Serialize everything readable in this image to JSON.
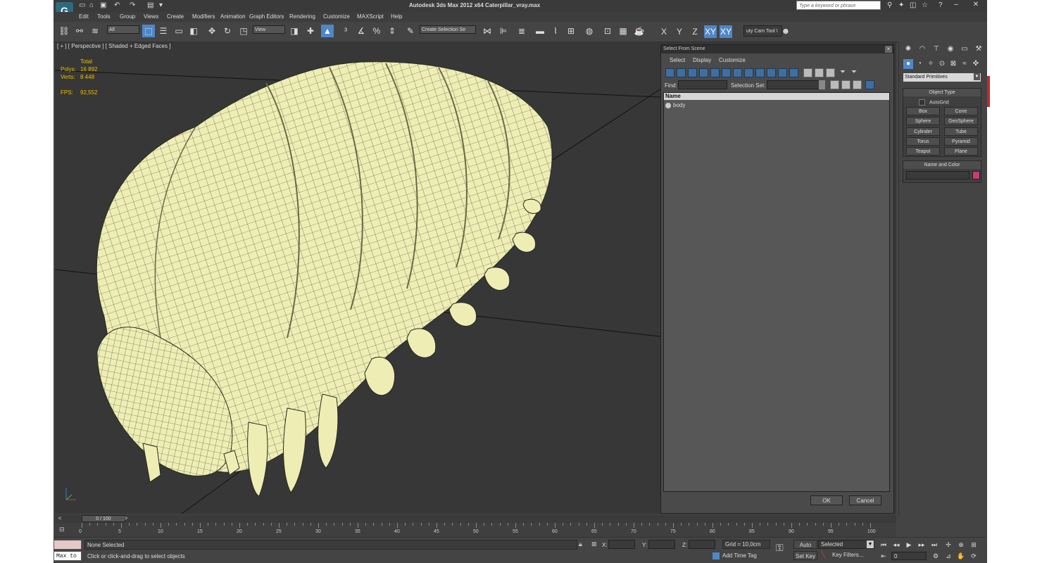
{
  "app": {
    "title": "Autodesk 3ds Max  2012 x64     Caterpillar_vray.max",
    "search_placeholder": "Type a keyword or phrase",
    "logo_letter": "G"
  },
  "menu": [
    "Edit",
    "Tools",
    "Group",
    "Views",
    "Create",
    "Modifiers",
    "Animation",
    "Graph Editors",
    "Rendering",
    "Customize",
    "MAXScript",
    "Help"
  ],
  "toolbar": {
    "filter_dropdown": "All",
    "coord_dropdown": "View",
    "selection_set_dropdown": "Create Selection Se",
    "axes": [
      "X",
      "Y",
      "Z",
      "XY",
      "XY"
    ],
    "cam_tool": "uty Cam Tool \\"
  },
  "viewport": {
    "label": "[ + ] [ Perspective ] [ Shaded + Edged Faces ]",
    "stats_header": "Total",
    "polys_label": "Polys:",
    "polys_value": "16 892",
    "verts_label": "Verts:",
    "verts_value": "8 448",
    "fps_label": "FPS:",
    "fps_value": "92,552",
    "mesh_color": "#eeeeb4",
    "wire_color": "#3a3a30"
  },
  "select_dialog": {
    "title": "Select From Scene",
    "menu": [
      "Select",
      "Display",
      "Customize"
    ],
    "find_label": "Find:",
    "selection_set_label": "Selection Set:",
    "column_name": "Name",
    "objects": [
      "body"
    ],
    "ok": "OK",
    "cancel": "Cancel"
  },
  "command_panel": {
    "dropdown": "Standard Primitives",
    "object_type_title": "Object Type",
    "autogrid": "AutoGrid",
    "primitives": [
      "Box",
      "Cone",
      "Sphere",
      "GeoSphere",
      "Cylinder",
      "Tube",
      "Torus",
      "Pyramid",
      "Teapot",
      "Plane"
    ],
    "name_color_title": "Name and Color",
    "object_color": "#c83a7a"
  },
  "timeline": {
    "slider_text": "0 / 100",
    "ticks": [
      "0",
      "5",
      "10",
      "15",
      "20",
      "25",
      "30",
      "35",
      "40",
      "45",
      "50",
      "55",
      "60",
      "65",
      "70",
      "75",
      "80",
      "85",
      "90",
      "95",
      "100"
    ]
  },
  "status": {
    "maxscript_label": "Max to",
    "selection_status": "None Selected",
    "prompt": "Click or click-and-drag to select objects",
    "x_label": "X:",
    "y_label": "Y:",
    "z_label": "Z:",
    "grid": "Grid = 10,0cm",
    "add_time_tag": "Add Time Tag",
    "auto_key": "Auto Key",
    "set_key": "Set Key",
    "key_mode": "Selected",
    "key_filters": "Key Filters...",
    "frame": "0"
  }
}
